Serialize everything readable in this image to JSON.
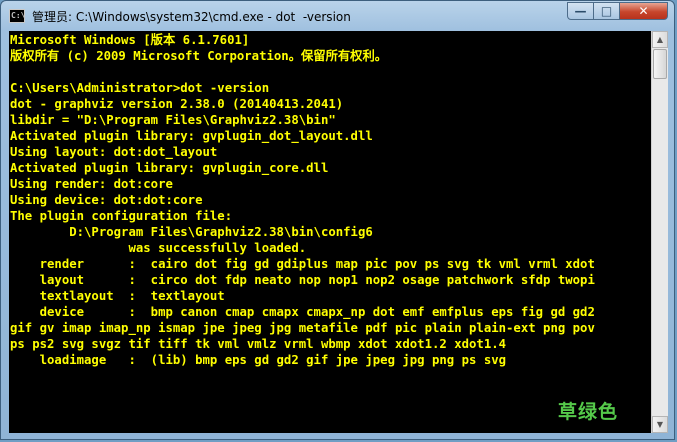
{
  "window": {
    "title": "管理员: C:\\Windows\\system32\\cmd.exe - dot  -version",
    "icon_label": "C:\\",
    "minimize_glyph": "—",
    "maximize_glyph": "□",
    "close_glyph": "✕"
  },
  "console": {
    "lines": [
      "Microsoft Windows [版本 6.1.7601]",
      "版权所有 (c) 2009 Microsoft Corporation。保留所有权利。",
      "",
      "C:\\Users\\Administrator>dot -version",
      "dot - graphviz version 2.38.0 (20140413.2041)",
      "libdir = \"D:\\Program Files\\Graphviz2.38\\bin\"",
      "Activated plugin library: gvplugin_dot_layout.dll",
      "Using layout: dot:dot_layout",
      "Activated plugin library: gvplugin_core.dll",
      "Using render: dot:core",
      "Using device: dot:dot:core",
      "The plugin configuration file:",
      "        D:\\Program Files\\Graphviz2.38\\bin\\config6",
      "                was successfully loaded.",
      "    render      :  cairo dot fig gd gdiplus map pic pov ps svg tk vml vrml xdot",
      "    layout      :  circo dot fdp neato nop nop1 nop2 osage patchwork sfdp twopi",
      "    textlayout  :  textlayout",
      "    device      :  bmp canon cmap cmapx cmapx_np dot emf emfplus eps fig gd gd2",
      "gif gv imap imap_np ismap jpe jpeg jpg metafile pdf pic plain plain-ext png pov",
      "ps ps2 svg svgz tif tiff tk vml vmlz vrml wbmp xdot xdot1.2 xdot1.4",
      "    loadimage   :  (lib) bmp eps gd gd2 gif jpe jpeg jpg png ps svg"
    ]
  },
  "watermark": {
    "text": "草绿色"
  },
  "colors": {
    "console_text": "#ffff00",
    "console_bg": "#000000",
    "watermark": "#55c94a"
  }
}
